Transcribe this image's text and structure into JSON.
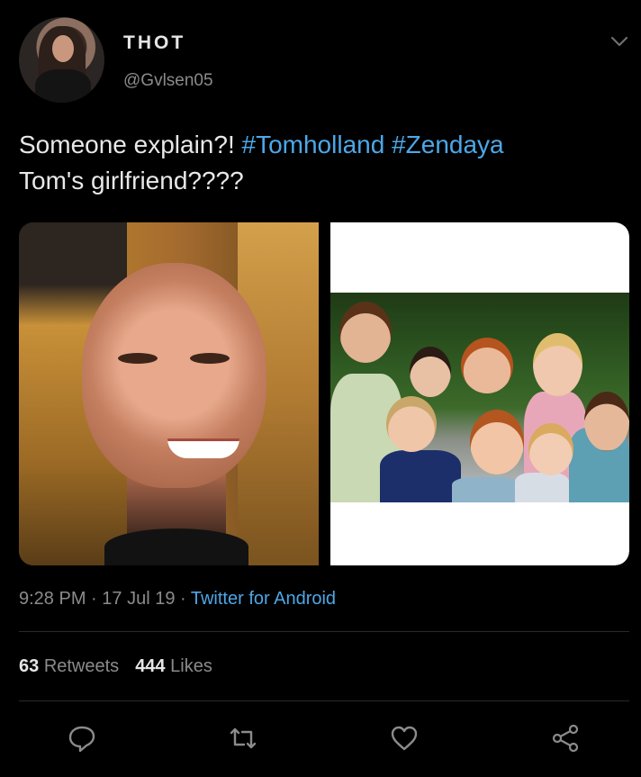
{
  "user": {
    "display_name": "THOT",
    "handle": "@Gvlsen05"
  },
  "tweet": {
    "text_plain_1": "Someone explain?! ",
    "hashtag_1": "#Tomholland",
    "text_plain_2": " ",
    "hashtag_2": "#Zendaya",
    "text_line_2": "Tom's girlfriend????"
  },
  "meta": {
    "time": "9:28 PM",
    "sep1": " · ",
    "date": "17 Jul 19",
    "sep2": " · ",
    "source": "Twitter for Android"
  },
  "stats": {
    "retweets_count": "63",
    "retweets_label": "Retweets",
    "likes_count": "444",
    "likes_label": "Likes"
  },
  "icons": {
    "menu": "chevron-down-icon",
    "reply": "reply-icon",
    "retweet": "retweet-icon",
    "like": "heart-icon",
    "share": "share-icon"
  },
  "colors": {
    "background": "#000000",
    "accent": "#4da7e8",
    "muted": "#8b8b8b",
    "text": "#e8e8e8"
  }
}
